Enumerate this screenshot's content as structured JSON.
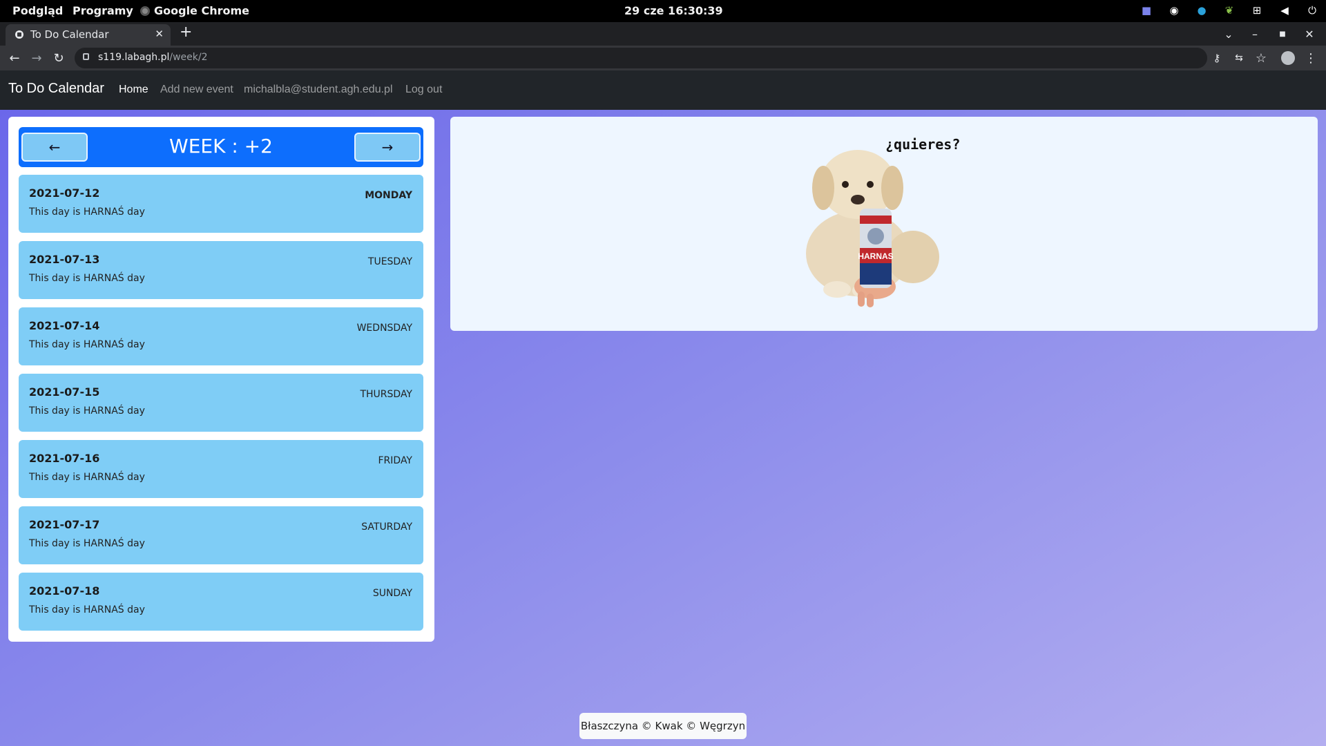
{
  "os_bar": {
    "menu_preview": "Podgląd",
    "menu_programs": "Programy",
    "menu_app": "Google Chrome",
    "clock": "29 cze  16:30:39"
  },
  "browser": {
    "tab_title": "To Do Calendar",
    "url_host": "s119.labagh.pl",
    "url_path": "/week/2"
  },
  "navbar": {
    "brand": "To Do Calendar",
    "home": "Home",
    "add_event": "Add new event",
    "user_email": "michalbla@student.agh.edu.pl",
    "logout": "Log out"
  },
  "week": {
    "title": "WEEK : +2",
    "prev_label": "←",
    "next_label": "→"
  },
  "days": [
    {
      "date": "2021-07-12",
      "weekday": "MONDAY",
      "note": "This day is HARNAŚ day"
    },
    {
      "date": "2021-07-13",
      "weekday": "TUESDAY",
      "note": "This day is HARNAŚ day"
    },
    {
      "date": "2021-07-14",
      "weekday": "WEDNSDAY",
      "note": "This day is HARNAŚ day"
    },
    {
      "date": "2021-07-15",
      "weekday": "THURSDAY",
      "note": "This day is HARNAŚ day"
    },
    {
      "date": "2021-07-16",
      "weekday": "FRIDAY",
      "note": "This day is HARNAŚ day"
    },
    {
      "date": "2021-07-17",
      "weekday": "SATURDAY",
      "note": "This day is HARNAŚ day"
    },
    {
      "date": "2021-07-18",
      "weekday": "SUNDAY",
      "note": "This day is HARNAŚ day"
    }
  ],
  "meme": {
    "caption": "¿quieres?",
    "can_label": "HARNAS"
  },
  "footer": {
    "text": "Błaszczyna © Kwak © Węgrzyn"
  }
}
